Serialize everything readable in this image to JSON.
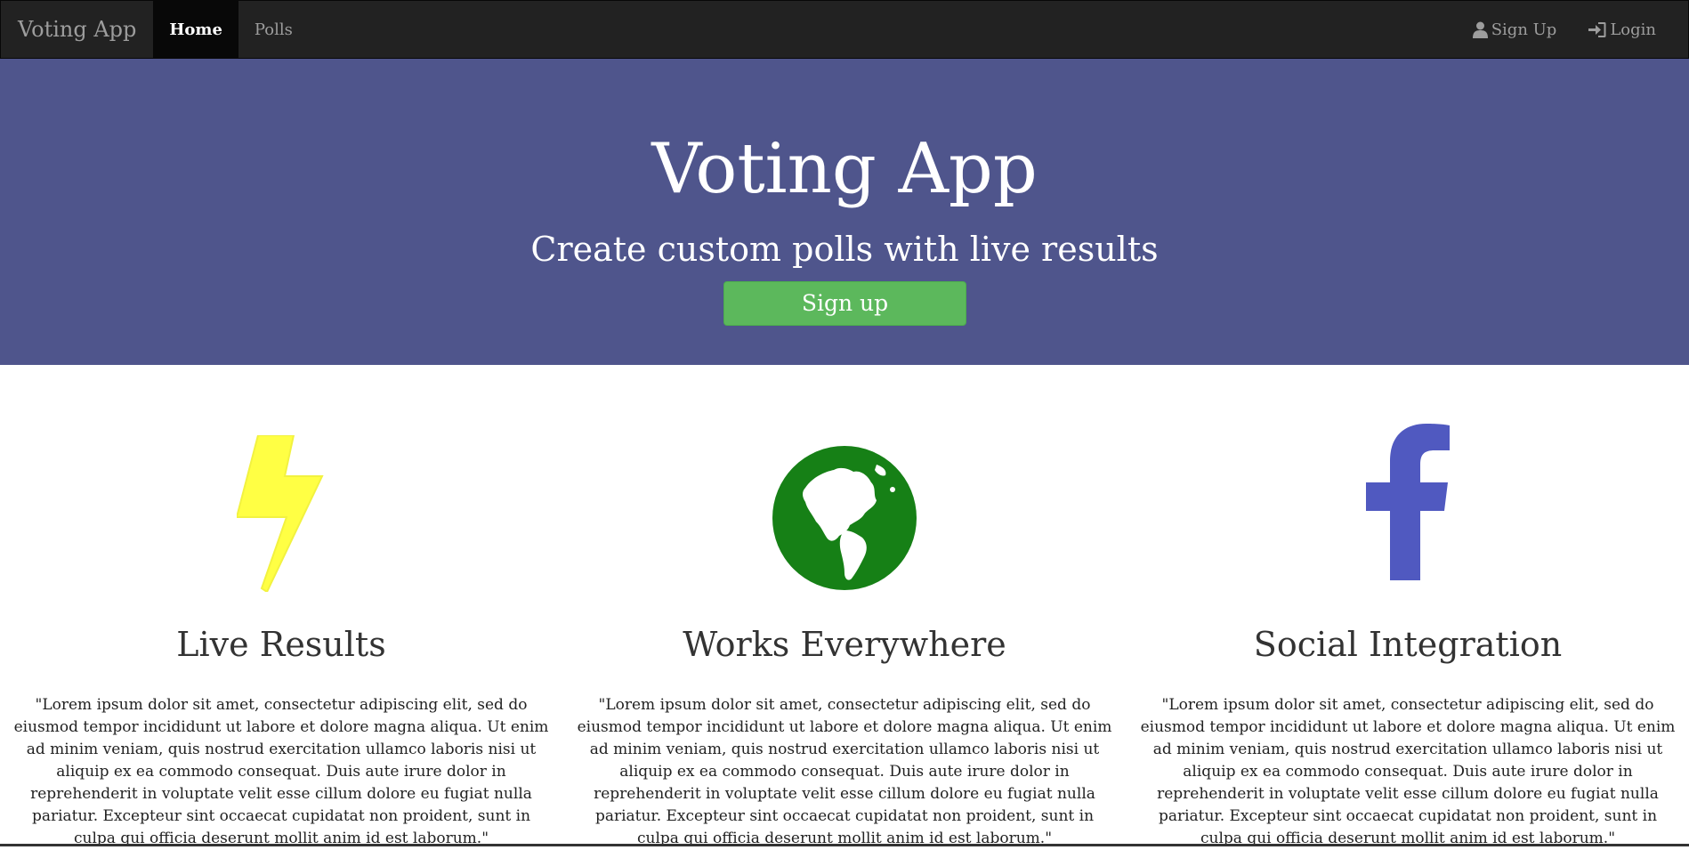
{
  "navbar": {
    "brand": "Voting App",
    "items": [
      {
        "label": "Home",
        "active": true
      },
      {
        "label": "Polls",
        "active": false
      }
    ],
    "right": [
      {
        "label": "Sign Up",
        "icon": "user-icon"
      },
      {
        "label": "Login",
        "icon": "login-icon"
      }
    ]
  },
  "hero": {
    "title": "Voting App",
    "subtitle": "Create custom polls with live results",
    "button_label": "Sign up",
    "background_color": "#4f558c",
    "button_color": "#5cb85c"
  },
  "features": [
    {
      "title": "Live Results",
      "icon": "lightning-bolt-icon",
      "icon_color": "#ffff44",
      "text": "\"Lorem ipsum dolor sit amet, consectetur adipiscing elit, sed do eiusmod tempor incididunt ut labore et dolore magna aliqua. Ut enim ad minim veniam, quis nostrud exercitation ullamco laboris nisi ut aliquip ex ea commodo consequat. Duis aute irure dolor in reprehenderit in voluptate velit esse cillum dolore eu fugiat nulla pariatur. Excepteur sint occaecat cupidatat non proident, sunt in culpa qui officia deserunt mollit anim id est laborum.\""
    },
    {
      "title": "Works Everywhere",
      "icon": "globe-icon",
      "icon_color": "#168016",
      "text": "\"Lorem ipsum dolor sit amet, consectetur adipiscing elit, sed do eiusmod tempor incididunt ut labore et dolore magna aliqua. Ut enim ad minim veniam, quis nostrud exercitation ullamco laboris nisi ut aliquip ex ea commodo consequat. Duis aute irure dolor in reprehenderit in voluptate velit esse cillum dolore eu fugiat nulla pariatur. Excepteur sint occaecat cupidatat non proident, sunt in culpa qui officia deserunt mollit anim id est laborum.\""
    },
    {
      "title": "Social Integration",
      "icon": "facebook-icon",
      "icon_color": "#5059c0",
      "text": "\"Lorem ipsum dolor sit amet, consectetur adipiscing elit, sed do eiusmod tempor incididunt ut labore et dolore magna aliqua. Ut enim ad minim veniam, quis nostrud exercitation ullamco laboris nisi ut aliquip ex ea commodo consequat. Duis aute irure dolor in reprehenderit in voluptate velit esse cillum dolore eu fugiat nulla pariatur. Excepteur sint occaecat cupidatat non proident, sunt in culpa qui officia deserunt mollit anim id est laborum.\""
    }
  ]
}
